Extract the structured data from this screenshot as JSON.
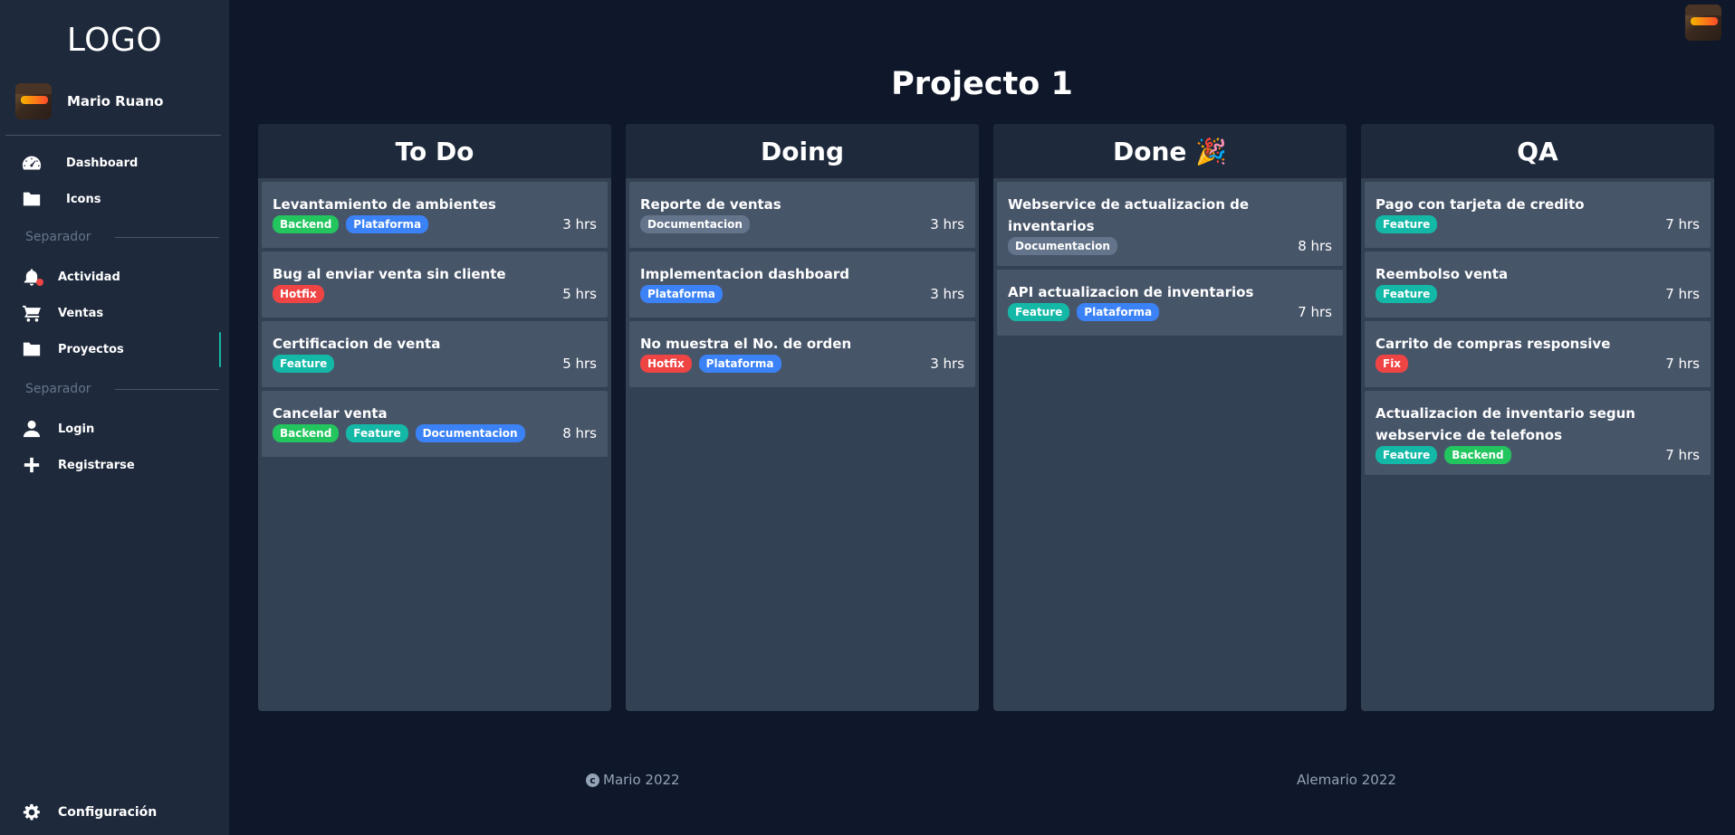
{
  "sidebar": {
    "logo": "LOGO",
    "user_name": "Mario Ruano",
    "items": [
      {
        "label": "Dashboard",
        "icon": "gauge-icon"
      },
      {
        "label": "Icons",
        "icon": "folder-icon"
      },
      {
        "label": "Actividad",
        "icon": "bell-icon"
      },
      {
        "label": "Ventas",
        "icon": "cart-icon"
      },
      {
        "label": "Proyectos",
        "icon": "folder-icon"
      },
      {
        "label": "Login",
        "icon": "user-icon"
      },
      {
        "label": "Registrarse",
        "icon": "plus-icon"
      }
    ],
    "separators": [
      "Separador",
      "Separador"
    ],
    "settings_label": "Configuración"
  },
  "page": {
    "title": "Projecto 1"
  },
  "columns": [
    {
      "title": "To Do",
      "cards": [
        {
          "title": "Levantamiento de ambientes",
          "tags": [
            "Backend",
            "Plataforma"
          ],
          "hours": "3 hrs"
        },
        {
          "title": "Bug al enviar venta sin cliente",
          "tags": [
            "Hotfix"
          ],
          "hours": "5 hrs"
        },
        {
          "title": "Certificacion de venta",
          "tags": [
            "Feature"
          ],
          "hours": "5 hrs"
        },
        {
          "title": "Cancelar venta",
          "tags": [
            "Backend",
            "Feature",
            "Documentacion"
          ],
          "hours": "8 hrs"
        }
      ]
    },
    {
      "title": "Doing",
      "cards": [
        {
          "title": "Reporte de ventas",
          "tags": [
            "Documentacion"
          ],
          "hours": "3 hrs"
        },
        {
          "title": "Implementacion dashboard",
          "tags": [
            "Plataforma"
          ],
          "hours": "3 hrs"
        },
        {
          "title": "No muestra el No. de orden",
          "tags": [
            "Hotfix",
            "Plataforma"
          ],
          "hours": "3 hrs"
        }
      ]
    },
    {
      "title": "Done 🎉",
      "cards": [
        {
          "title": "Webservice de actualizacion de inventarios",
          "tags": [
            "Documentacion"
          ],
          "hours": "8 hrs"
        },
        {
          "title": "API actualizacion de inventarios",
          "tags": [
            "Feature",
            "Plataforma"
          ],
          "hours": "7 hrs"
        }
      ]
    },
    {
      "title": "QA",
      "cards": [
        {
          "title": "Pago con tarjeta de credito",
          "tags": [
            "Feature"
          ],
          "hours": "7 hrs"
        },
        {
          "title": "Reembolso venta",
          "tags": [
            "Feature"
          ],
          "hours": "7 hrs"
        },
        {
          "title": "Carrito de compras responsive",
          "tags": [
            "Fix"
          ],
          "hours": "7 hrs"
        },
        {
          "title": "Actualizacion de inventario segun webservice de telefonos",
          "tags": [
            "Feature",
            "Backend"
          ],
          "hours": "7 hrs"
        }
      ]
    }
  ],
  "tag_colors": {
    "Backend": "#22c55e",
    "Plataforma": "#3b82f6",
    "Hotfix": "#ef4444",
    "Fix": "#ef4444",
    "Feature": "#14b8a6",
    "Documentacion": "#64748b"
  },
  "footer": {
    "left": "Mario 2022",
    "right": "Alemario 2022"
  },
  "colors": {
    "background": "#0f172a",
    "sidebar": "#1e293b",
    "column": "#334155",
    "card": "#475569",
    "active_accent": "#14b8a6"
  }
}
